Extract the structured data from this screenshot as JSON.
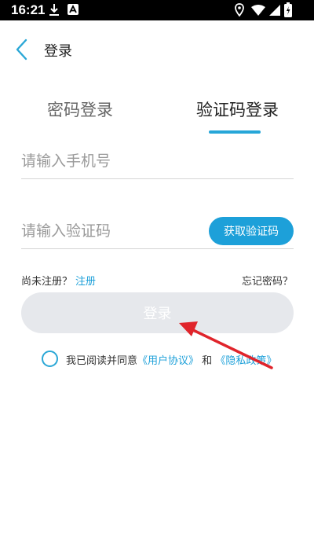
{
  "status_bar": {
    "time": "16:21"
  },
  "header": {
    "title": "登录"
  },
  "tabs": [
    {
      "label": "密码登录",
      "active": false
    },
    {
      "label": "验证码登录",
      "active": true
    }
  ],
  "form": {
    "phone_placeholder": "请输入手机号",
    "code_placeholder": "请输入验证码",
    "get_code_label": "获取验证码",
    "register_prompt": "尚未注册？",
    "register_link": "注册",
    "forgot_label": "忘记密码？",
    "login_label": "登录"
  },
  "agreement": {
    "prefix": "我已阅读并同意",
    "user_agreement": "《用户协议》",
    "and": "和",
    "privacy_policy": "《隐私政策》"
  },
  "colors": {
    "accent": "#1da0d9",
    "login_disabled_bg": "#e6e8ec",
    "annotation_arrow": "#e0242b"
  }
}
